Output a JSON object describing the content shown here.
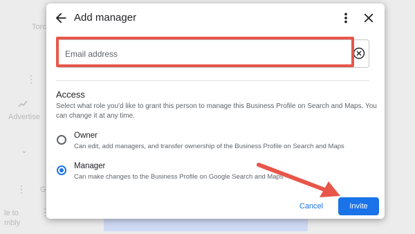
{
  "dialog": {
    "title": "Add manager",
    "email": {
      "placeholder": "Email address",
      "value": ""
    },
    "access": {
      "title": "Access",
      "description": "Select what role you'd like to grant this person to manage this Business Profile on Search and Maps. You can change it at any time.",
      "roles": [
        {
          "name": "Owner",
          "description": "Can edit, add managers, and transfer ownership of the Business Profile on Search and Maps",
          "selected": false
        },
        {
          "name": "Manager",
          "description": "Can make changes to the Business Profile on Google Search and Maps",
          "selected": true
        }
      ]
    },
    "actions": {
      "cancel": "Cancel",
      "invite": "Invite"
    }
  },
  "background": {
    "tab_label": "Torc",
    "advertise_label": "Advertise",
    "side_text_1": "le to",
    "side_text_2": "mbly",
    "g_letter": "G"
  },
  "colors": {
    "accent": "#1a73e8",
    "highlight": "#e8564a"
  },
  "icons": {
    "back": "arrow-left-icon",
    "more": "more-vert-icon",
    "close": "close-icon",
    "clear": "clear-circle-icon"
  }
}
